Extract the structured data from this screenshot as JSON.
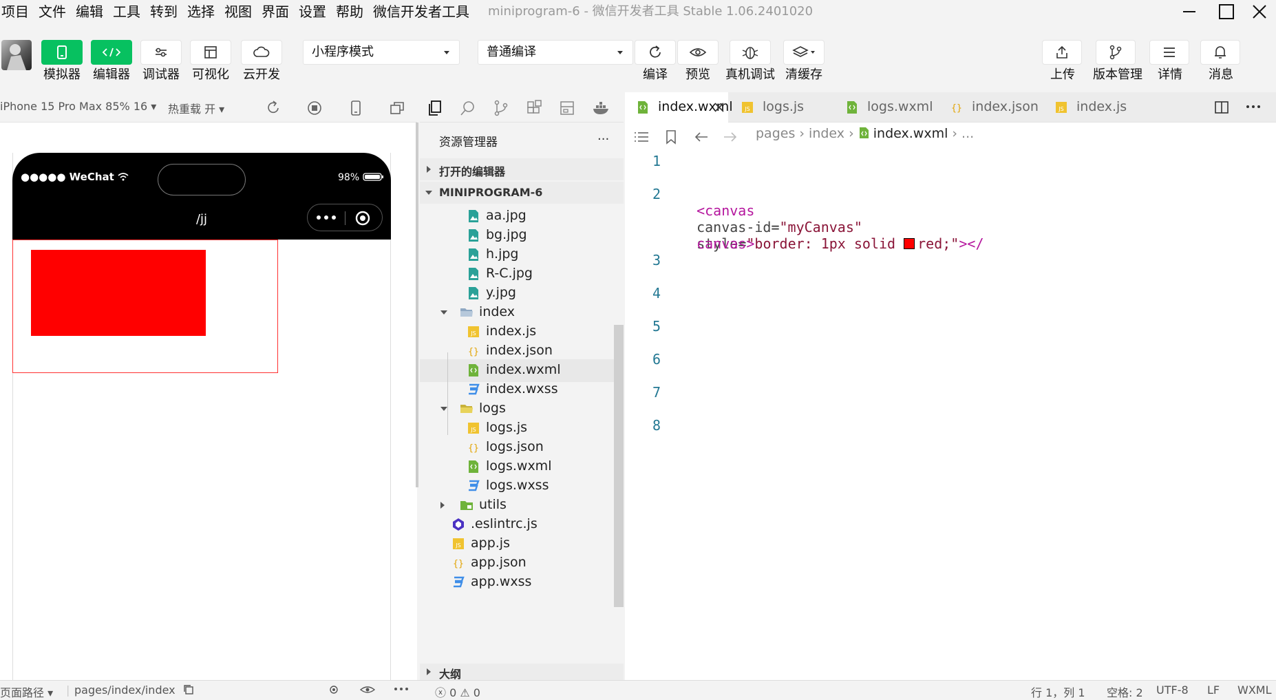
{
  "menu": {
    "items": [
      "项目",
      "文件",
      "编辑",
      "工具",
      "转到",
      "选择",
      "视图",
      "界面",
      "设置",
      "帮助",
      "微信开发者工具"
    ],
    "window_title": "miniprogram-6 - 微信开发者工具 Stable 1.06.2401020"
  },
  "toolbar": {
    "left_buttons": [
      {
        "label": "模拟器",
        "icon": "phone-icon",
        "active": true
      },
      {
        "label": "编辑器",
        "icon": "code-icon",
        "active": true
      },
      {
        "label": "调试器",
        "icon": "sliders-icon",
        "active": false
      },
      {
        "label": "可视化",
        "icon": "layout-icon",
        "active": false
      },
      {
        "label": "云开发",
        "icon": "cloud-icon",
        "active": false
      }
    ],
    "mode_select": "小程序模式",
    "compile_select": "普通编译",
    "mid_buttons": [
      {
        "label": "编译",
        "icon": "refresh-icon"
      },
      {
        "label": "预览",
        "icon": "eye-icon"
      },
      {
        "label": "真机调试",
        "icon": "bug-icon"
      },
      {
        "label": "清缓存",
        "icon": "layers-icon"
      }
    ],
    "right_buttons": [
      {
        "label": "上传",
        "icon": "upload-icon"
      },
      {
        "label": "版本管理",
        "icon": "branch-icon"
      },
      {
        "label": "详情",
        "icon": "menu-icon"
      },
      {
        "label": "消息",
        "icon": "bell-icon"
      }
    ]
  },
  "simulator": {
    "device": "iPhone 15 Pro Max 85% 16",
    "hot_reload": "热重载 开",
    "status_carrier": "●●●●● WeChat",
    "battery": "98%",
    "nav_title": "/jj"
  },
  "explorer": {
    "title": "资源管理器",
    "more": "···",
    "open_editors": "打开的编辑器",
    "project": "MINIPROGRAM-6",
    "outline": "大纲",
    "tree": [
      {
        "name": "aa.jpg",
        "type": "image",
        "depth": 2
      },
      {
        "name": "bg.jpg",
        "type": "image",
        "depth": 2
      },
      {
        "name": "h.jpg",
        "type": "image",
        "depth": 2
      },
      {
        "name": "R-C.jpg",
        "type": "image",
        "depth": 2
      },
      {
        "name": "y.jpg",
        "type": "image",
        "depth": 2
      },
      {
        "name": "index",
        "type": "folder-open",
        "depth": 1
      },
      {
        "name": "index.js",
        "type": "js",
        "depth": 2
      },
      {
        "name": "index.json",
        "type": "json",
        "depth": 2
      },
      {
        "name": "index.wxml",
        "type": "wxml",
        "depth": 2,
        "selected": true
      },
      {
        "name": "index.wxss",
        "type": "wxss",
        "depth": 2
      },
      {
        "name": "logs",
        "type": "folder-open-logs",
        "depth": 1
      },
      {
        "name": "logs.js",
        "type": "js",
        "depth": 2
      },
      {
        "name": "logs.json",
        "type": "json",
        "depth": 2
      },
      {
        "name": "logs.wxml",
        "type": "wxml",
        "depth": 2
      },
      {
        "name": "logs.wxss",
        "type": "wxss",
        "depth": 2
      },
      {
        "name": "utils",
        "type": "folder-closed",
        "depth": 1
      },
      {
        "name": ".eslintrc.js",
        "type": "eslint",
        "depth": 1
      },
      {
        "name": "app.js",
        "type": "js",
        "depth": 1
      },
      {
        "name": "app.json",
        "type": "json",
        "depth": 1
      },
      {
        "name": "app.wxss",
        "type": "wxss",
        "depth": 1
      }
    ]
  },
  "editor": {
    "tabs": [
      {
        "name": "index.wxml",
        "type": "wxml",
        "active": true
      },
      {
        "name": "logs.js",
        "type": "js",
        "active": false
      },
      {
        "name": "logs.wxml",
        "type": "wxml",
        "active": false
      },
      {
        "name": "index.json",
        "type": "json",
        "active": false
      },
      {
        "name": "index.js",
        "type": "js",
        "active": false
      }
    ],
    "breadcrumb": [
      "pages",
      "index",
      "index.wxml",
      "..."
    ],
    "line_numbers": [
      "1",
      "2",
      "3",
      "4",
      "5",
      "6",
      "7",
      "8"
    ],
    "code": {
      "open_tag": "<canvas",
      "attr1": "canvas-id",
      "eq": "=",
      "val1": "\"myCanvas\"",
      "attr2": "style",
      "val2a": "\"border: 1px solid ",
      "val2b": "red;\"",
      "close_a": "></",
      "close_b": "canvas>"
    },
    "swatch_color": "#ff0000"
  },
  "statusbar": {
    "page_path_label": "页面路径",
    "page_path": "pages/index/index",
    "problems": "ⓧ 0 ⚠ 0",
    "position": "行 1，列 1",
    "spaces": "空格: 2",
    "encoding": "UTF-8",
    "eol": "LF",
    "language": "WXML"
  }
}
